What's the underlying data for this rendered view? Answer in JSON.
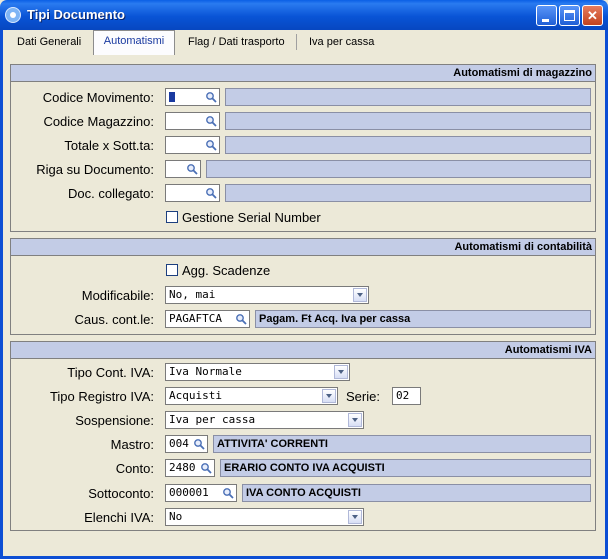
{
  "window": {
    "title": "Tipi Documento"
  },
  "tabs": [
    "Dati Generali",
    "Automatismi",
    "Flag / Dati trasporto",
    "Iva per cassa"
  ],
  "magazzino": {
    "header": "Automatismi di magazzino",
    "codice_movimento": {
      "label": "Codice Movimento:",
      "value": ""
    },
    "codice_magazzino": {
      "label": "Codice Magazzino:",
      "value": ""
    },
    "totale_sott": {
      "label": "Totale x Sott.ta:",
      "value": ""
    },
    "riga_documento": {
      "label": "Riga su Documento:",
      "value": ""
    },
    "doc_collegato": {
      "label": "Doc. collegato:",
      "value": ""
    },
    "serial_number": {
      "label": "Gestione Serial Number",
      "checked": false
    }
  },
  "contabilita": {
    "header": "Automatismi di contabilità",
    "agg_scadenze": {
      "label": "Agg. Scadenze",
      "checked": false
    },
    "modificabile": {
      "label": "Modificabile:",
      "value": "No, mai"
    },
    "causale": {
      "label": "Caus. cont.le:",
      "code": "PAGAFTCA",
      "description": "Pagam. Ft Acq. Iva per cassa"
    }
  },
  "iva": {
    "header": "Automatismi IVA",
    "tipo_cont": {
      "label": "Tipo Cont. IVA:",
      "value": "Iva Normale"
    },
    "tipo_registro": {
      "label": "Tipo Registro IVA:",
      "value": "Acquisti"
    },
    "serie": {
      "label": "Serie:",
      "value": "02"
    },
    "sospensione": {
      "label": "Sospensione:",
      "value": "Iva per cassa"
    },
    "mastro": {
      "label": "Mastro:",
      "code": "004",
      "description": "ATTIVITA' CORRENTI"
    },
    "conto": {
      "label": "Conto:",
      "code": "2480",
      "description": "ERARIO CONTO IVA ACQUISTI"
    },
    "sottoconto": {
      "label": "Sottoconto:",
      "code": "000001",
      "description": "IVA CONTO ACQUISTI"
    },
    "elenchi": {
      "label": "Elenchi IVA:",
      "value": "No"
    }
  },
  "icons": [
    "app-icon",
    "minimize-icon",
    "maximize-icon",
    "close-icon",
    "lookup-icon",
    "chevron-down-icon"
  ]
}
